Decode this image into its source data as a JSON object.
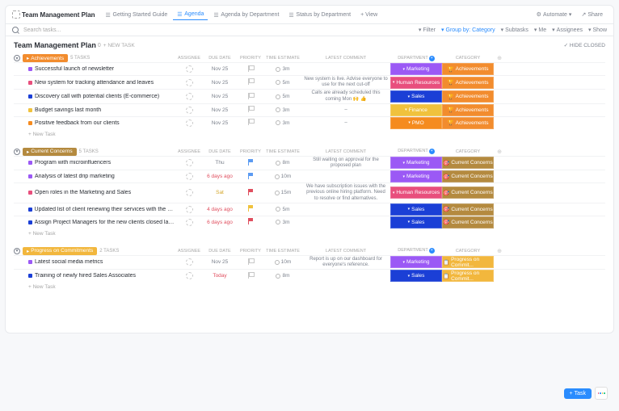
{
  "header": {
    "title": "Team Management Plan",
    "views": [
      {
        "label": "Getting Started Guide",
        "active": false
      },
      {
        "label": "Agenda",
        "active": true
      },
      {
        "label": "Agenda by Department",
        "active": false
      },
      {
        "label": "Status by Department",
        "active": false
      }
    ],
    "add_view": "+ View",
    "automate": "Automate",
    "share": "Share"
  },
  "toolbar": {
    "search_placeholder": "Search tasks...",
    "filters": [
      {
        "label": "Filter"
      },
      {
        "label": "Group by: Category",
        "active": true
      },
      {
        "label": "Subtasks"
      },
      {
        "label": "Me"
      },
      {
        "label": "Assignees"
      },
      {
        "label": "Show"
      }
    ]
  },
  "page": {
    "title": "Team Management Plan",
    "count_badge": "0",
    "new_task": "+ NEW TASK",
    "hide_closed": "✓ HIDE CLOSED"
  },
  "columns": [
    "ASSIGNEE",
    "DUE DATE",
    "PRIORITY",
    "TIME ESTIMATE",
    "LATEST COMMENT",
    "DEPARTMENT",
    "CATEGORY"
  ],
  "new_task_label": "+ New Task",
  "groups": [
    {
      "name": "Achievements",
      "pill_color": "#f28c2e",
      "task_count": "5 TASKS",
      "tasks": [
        {
          "color": "#9b59f5",
          "name": "Successful launch of newsletter",
          "due": "Nov 25",
          "prio": "none",
          "est": "3m",
          "comment": "",
          "dept": "Marketing",
          "dept_color": "#9b59f5",
          "cat": "Achievements",
          "cat_color": "#f28c2e"
        },
        {
          "color": "#e84f7d",
          "name": "New system for tracking attendance and leaves",
          "due": "Nov 25",
          "prio": "none",
          "est": "5m",
          "comment": "New system is live. Advise everyone to use for the next cut-off",
          "dept": "Human Resources",
          "dept_color": "#e84f7d",
          "cat": "Achievements",
          "cat_color": "#f28c2e"
        },
        {
          "color": "#1b3fd6",
          "name": "Discovery call with potential clients (E-commerce)",
          "due": "Nov 25",
          "prio": "none",
          "est": "5m",
          "comment": "Calls are already scheduled this coming Mon 🙌 👍",
          "dept": "Sales",
          "dept_color": "#1b3fd6",
          "cat": "Achievements",
          "cat_color": "#f28c2e"
        },
        {
          "color": "#f0c23d",
          "name": "Budget savings last month",
          "due": "Nov 25",
          "prio": "none",
          "est": "3m",
          "comment": "–",
          "dept": "Finance",
          "dept_color": "#f0c23d",
          "cat": "Achievements",
          "cat_color": "#f28c2e"
        },
        {
          "color": "#f58b1f",
          "name": "Positive feedback from our clients",
          "due": "Nov 25",
          "prio": "none",
          "est": "3m",
          "comment": "–",
          "dept": "PMO",
          "dept_color": "#f58b1f",
          "cat": "Achievements",
          "cat_color": "#f28c2e"
        }
      ]
    },
    {
      "name": "Current Concerns",
      "pill_color": "#b48a3f",
      "task_count": "5 TASKS",
      "tasks": [
        {
          "color": "#9b59f5",
          "name": "Program with microinfluencers",
          "due": "Thu",
          "due_cls": "",
          "prio": "blue",
          "est": "8m",
          "comment": "Still waiting on approval for the proposed plan",
          "dept": "Marketing",
          "dept_color": "#9b59f5",
          "cat": "Current Concerns",
          "cat_color": "#b48a3f"
        },
        {
          "color": "#9b59f5",
          "name": "Analysis of latest drip marketing",
          "due": "6 days ago",
          "due_cls": "red",
          "prio": "blue",
          "est": "10m",
          "comment": "",
          "dept": "Marketing",
          "dept_color": "#9b59f5",
          "cat": "Current Concerns",
          "cat_color": "#b48a3f"
        },
        {
          "color": "#e84f7d",
          "name": "Open roles in the Marketing and Sales",
          "due": "Sat",
          "due_cls": "gold",
          "prio": "red",
          "est": "15m",
          "comment": "We have subscription issues with the previous online hiring platform. Need to resolve or find alternatives.",
          "dept": "Human Resources",
          "dept_color": "#e84f7d",
          "cat": "Current Concerns",
          "cat_color": "#b48a3f"
        },
        {
          "color": "#1b3fd6",
          "name": "Updated list of client renewing their services with the company",
          "due": "4 days ago",
          "due_cls": "red",
          "prio": "yellow",
          "est": "5m",
          "comment": "",
          "dept": "Sales",
          "dept_color": "#1b3fd6",
          "cat": "Current Concerns",
          "cat_color": "#b48a3f"
        },
        {
          "color": "#1b3fd6",
          "name": "Assign Project Managers for the new clients closed last week",
          "due": "6 days ago",
          "due_cls": "red",
          "prio": "red",
          "est": "3m",
          "comment": "",
          "dept": "Sales",
          "dept_color": "#1b3fd6",
          "cat": "Current Concerns",
          "cat_color": "#b48a3f"
        }
      ]
    },
    {
      "name": "Progress on Commitments",
      "pill_color": "#f2b73d",
      "task_count": "2 TASKS",
      "tasks": [
        {
          "color": "#9b59f5",
          "name": "Latest social media metrics",
          "due": "Nov 25",
          "prio": "none",
          "est": "10m",
          "comment": "Report is up on our dashboard for everyone's reference.",
          "dept": "Marketing",
          "dept_color": "#9b59f5",
          "cat": "Progress on Commit...",
          "cat_color": "#f2b73d"
        },
        {
          "color": "#1b3fd6",
          "name": "Training of newly hired Sales Associates",
          "due": "Today",
          "due_cls": "red",
          "prio": "none",
          "est": "8m",
          "comment": "",
          "dept": "Sales",
          "dept_color": "#1b3fd6",
          "cat": "Progress on Commit...",
          "cat_color": "#f2b73d"
        }
      ]
    }
  ],
  "cat_icons": {
    "Achievements": "🏆",
    "Current Concerns": "🎯",
    "Progress on Commit...": "📋"
  },
  "fab": {
    "label": "Task"
  }
}
